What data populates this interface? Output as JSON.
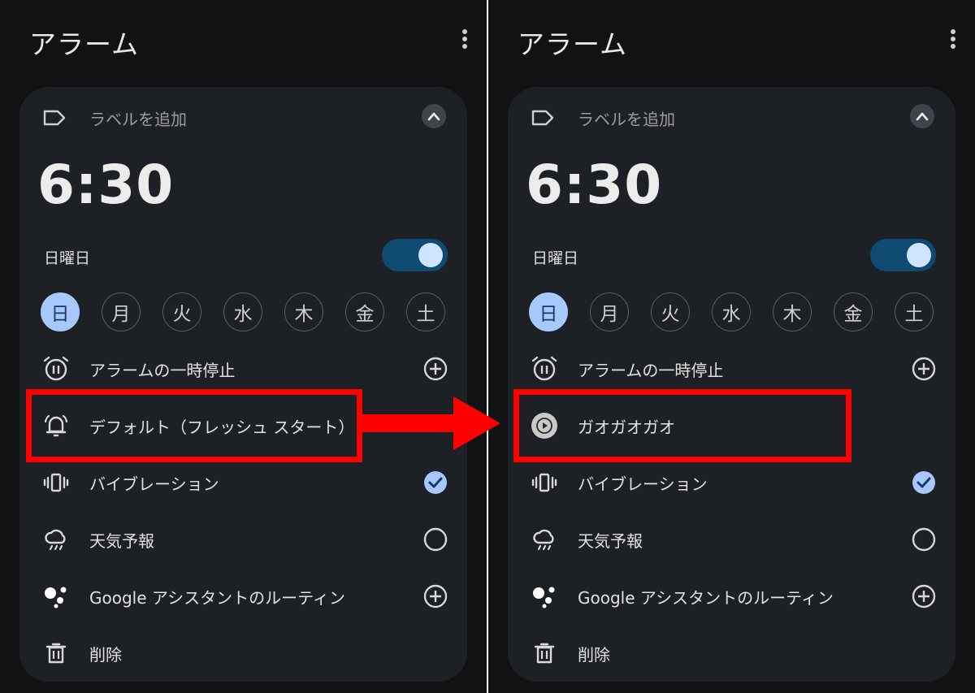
{
  "app_title": "アラーム",
  "label_placeholder": "ラベルを追加",
  "alarm_time": "6:30",
  "repeat_day_label": "日曜日",
  "days": [
    "日",
    "月",
    "火",
    "水",
    "木",
    "金",
    "土"
  ],
  "active_day_index": 0,
  "options": {
    "pause": "アラームの一時停止",
    "vibration": "バイブレーション",
    "weather": "天気予報",
    "assistant": "Google アシスタントのルーティン",
    "delete": "削除"
  },
  "left_panel": {
    "ringtone": "デフォルト（フレッシュ スタート）"
  },
  "right_panel": {
    "ringtone": "ガオガオガオ"
  },
  "colors": {
    "background": "#111214",
    "card": "#1d2024",
    "accent": "#a8c8fb",
    "toggle_track": "#0f4a72",
    "highlight": "#ff0000"
  },
  "icons": [
    "label-icon",
    "chevron-up-icon",
    "more-vert-icon",
    "pause-alarm-icon",
    "bell-icon",
    "play-icon",
    "vibration-icon",
    "weather-icon",
    "google-assistant-icon",
    "add-icon",
    "check-icon",
    "circle-icon",
    "delete-icon"
  ]
}
